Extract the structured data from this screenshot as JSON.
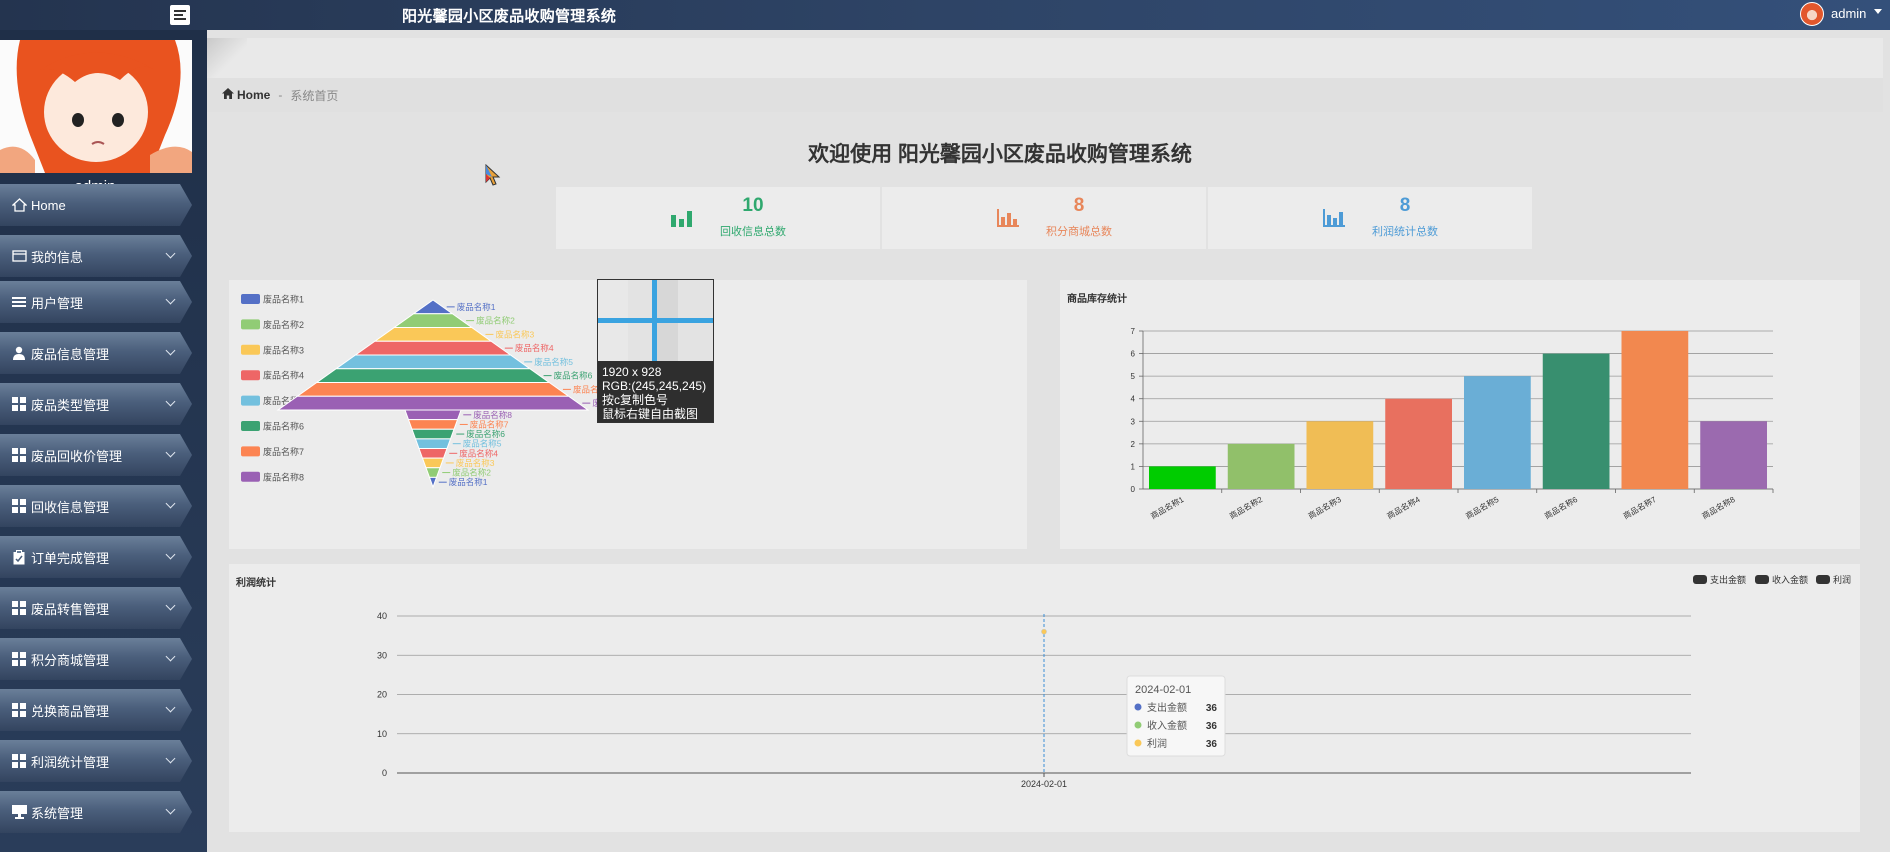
{
  "topbar": {
    "title": "阳光馨园小区废品收购管理系统",
    "username": "admin",
    "icons": [
      "menu-toggle-icon",
      "user-avatar",
      "caret-down-icon"
    ]
  },
  "sidebar": {
    "username": "admin",
    "items": [
      {
        "label": "Home",
        "icon": "home-icon",
        "has_submenu": false
      },
      {
        "label": "我的信息",
        "icon": "profile-card-icon",
        "has_submenu": true
      },
      {
        "label": "用户管理",
        "icon": "list-icon",
        "has_submenu": true
      },
      {
        "label": "废品信息管理",
        "icon": "user-icon",
        "has_submenu": true
      },
      {
        "label": "废品类型管理",
        "icon": "grid-icon",
        "has_submenu": true
      },
      {
        "label": "废品回收价管理",
        "icon": "grid-icon",
        "has_submenu": true
      },
      {
        "label": "回收信息管理",
        "icon": "grid-icon",
        "has_submenu": true
      },
      {
        "label": "订单完成管理",
        "icon": "clipboard-icon",
        "has_submenu": true
      },
      {
        "label": "废品转售管理",
        "icon": "grid-icon",
        "has_submenu": true
      },
      {
        "label": "积分商城管理",
        "icon": "grid-icon",
        "has_submenu": true
      },
      {
        "label": "兑换商品管理",
        "icon": "grid-icon",
        "has_submenu": true
      },
      {
        "label": "利润统计管理",
        "icon": "grid-icon",
        "has_submenu": true
      },
      {
        "label": "系统管理",
        "icon": "desktop-icon",
        "has_submenu": true
      }
    ]
  },
  "breadcrumb": {
    "home": "Home",
    "separator": "-",
    "current": "系统首页"
  },
  "welcome": "欢迎使用 阳光馨园小区废品收购管理系统",
  "stats": [
    {
      "value": "10",
      "label": "回收信息总数",
      "color": "#2fa86e"
    },
    {
      "value": "8",
      "label": "积分商城总数",
      "color": "#e8865a"
    },
    {
      "value": "8",
      "label": "利润统计总数",
      "color": "#4d9bd6"
    }
  ],
  "picker": {
    "size": "1920 x 928",
    "rgb": "RGB:(245,245,245)",
    "hint1": "按c复制色号",
    "hint2": "鼠标右键自由截图"
  },
  "chart_data": [
    {
      "type": "funnel",
      "title": "",
      "legend_position": "left",
      "categories": [
        "废品名称1",
        "废品名称2",
        "废品名称3",
        "废品名称4",
        "废品名称5",
        "废品名称6",
        "废品名称7",
        "废品名称8"
      ],
      "colors": [
        "#5470c6",
        "#91cc75",
        "#fac858",
        "#ee6666",
        "#73c0de",
        "#3ba272",
        "#fc8452",
        "#9a60b4"
      ],
      "series": [
        {
          "name": "",
          "values": [
            1,
            2,
            3,
            4,
            5,
            6,
            7,
            8
          ]
        },
        {
          "name": "",
          "values": [
            1,
            2,
            3,
            4,
            5,
            6,
            7,
            8
          ],
          "inverted": true
        }
      ]
    },
    {
      "type": "bar",
      "title": "商品库存统计",
      "categories": [
        "商品名称1",
        "商品名称2",
        "商品名称3",
        "商品名称4",
        "商品名称5",
        "商品名称6",
        "商品名称7",
        "商品名称8"
      ],
      "values": [
        1,
        2,
        3,
        4,
        5,
        6,
        7,
        3
      ],
      "colors": [
        "#00cc00",
        "#91c06a",
        "#f0bd55",
        "#e8705f",
        "#6aaed6",
        "#388f6f",
        "#f2884f",
        "#9b6aaf"
      ],
      "ylim": [
        0,
        7
      ],
      "yticks": [
        0,
        1,
        2,
        3,
        4,
        5,
        6,
        7
      ],
      "grid": true
    },
    {
      "type": "line",
      "title": "利润统计",
      "legend_position": "top-right",
      "x": [
        "2024-02-01"
      ],
      "series": [
        {
          "name": "支出金额",
          "values": [
            36
          ],
          "color": "#5470c6"
        },
        {
          "name": "收入金额",
          "values": [
            36
          ],
          "color": "#91cc75"
        },
        {
          "name": "利润",
          "values": [
            36
          ],
          "color": "#fac858"
        }
      ],
      "ylim": [
        0,
        40
      ],
      "yticks": [
        0,
        10,
        20,
        30,
        40
      ],
      "grid": true,
      "tooltip": {
        "title": "2024-02-01",
        "rows": [
          {
            "name": "支出金额",
            "value": "36"
          },
          {
            "name": "收入金额",
            "value": "36"
          },
          {
            "name": "利润",
            "value": "36"
          }
        ]
      }
    }
  ]
}
